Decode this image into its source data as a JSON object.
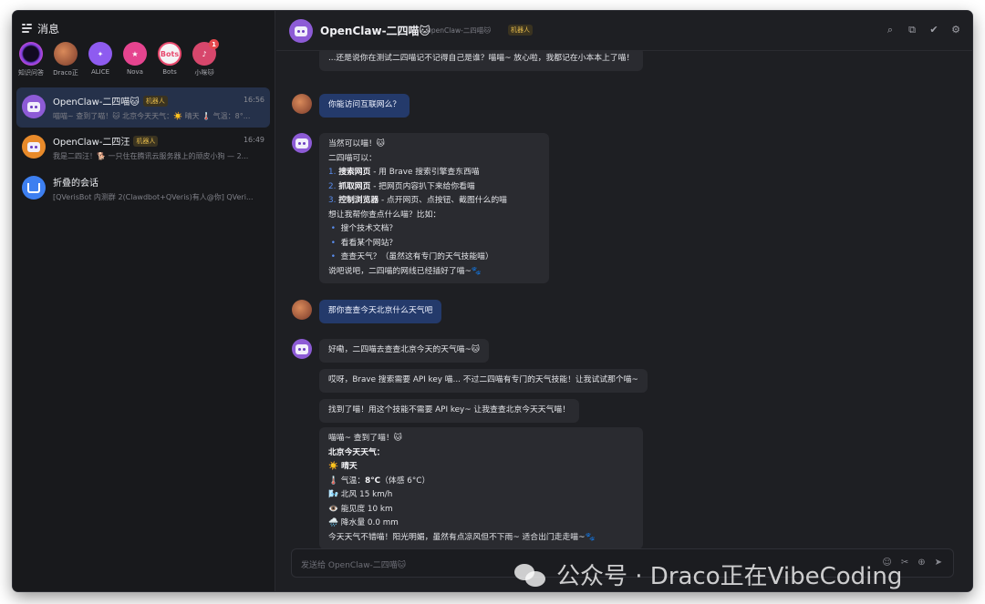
{
  "sidebar": {
    "title": "消息",
    "stories": [
      {
        "label": "知识问答",
        "avatar": "ring-icon",
        "color": "#7b3fe0"
      },
      {
        "label": "Draco正",
        "avatar": "photo-avatar",
        "color": "#b2673f"
      },
      {
        "label": "ALICE",
        "avatar": "spark-icon",
        "color": "#8e5bf0"
      },
      {
        "label": "Nova",
        "avatar": "star-icon",
        "color": "#e5448f"
      },
      {
        "label": "Bots",
        "avatar": "Bots",
        "color": "#e84a6e"
      },
      {
        "label": "小咪🐱",
        "avatar": "guitar-icon",
        "color": "#d7476c",
        "badge": "1"
      }
    ],
    "conversations": [
      {
        "name": "OpenClaw-二四喵🐱",
        "tag": "机器人",
        "time": "16:56",
        "preview": "喵喵~ 查到了喵！🐱 北京今天天气：☀️ 晴天 🌡️ 气温：8°..."
      },
      {
        "name": "OpenClaw-二四汪",
        "tag": "机器人",
        "time": "16:49",
        "preview": "我是二四汪！🐕 一只住在腾讯云服务器上的顽皮小狗 — 2..."
      },
      {
        "name": "折叠的会话",
        "preview": "[QVerisBot 内测群 2(Clawdbot+QVeris)有人@你] QVeri..."
      }
    ]
  },
  "chat": {
    "title": "OpenClaw-二四喵🐱",
    "subtitle": "OpenClaw-二四喵🐱",
    "tag": "机器人",
    "messages": {
      "m0": "...还是说你在测试二四喵记不记得自己是谁？喵喵~ 放心啦，我都记在小本本上了喵！",
      "m1": "你能访问互联网么？",
      "m2": {
        "l1": "当然可以喵！🐱",
        "l2": "二四喵可以：",
        "i1_num": "1.",
        "i1_b": "搜索网页",
        "i1_t": " - 用 Brave 搜索引擎查东西喵",
        "i2_num": "2.",
        "i2_b": "抓取网页",
        "i2_t": " - 把网页内容扒下来给你看喵",
        "i3_num": "3.",
        "i3_b": "控制浏览器",
        "i3_t": " - 点开网页、点按钮、截图什么的喵",
        "l3": "想让我帮你查点什么喵？比如：",
        "b1": "搜个技术文档？",
        "b2": "看看某个网站？",
        "b3": "查查天气？（虽然这有专门的天气技能喵）",
        "l4": "说吧说吧，二四喵的网线已经插好了喵~🐾"
      },
      "m3": "那你查查今天北京什么天气吧",
      "m4": "好嘞，二四喵去查查北京今天的天气喵~🐱",
      "m5": "哎呀，Brave 搜索需要 API key 喵... 不过二四喵有专门的天气技能！让我试试那个喵~",
      "m6": "找到了喵！用这个技能不需要 API key~ 让我查查北京今天天气喵！",
      "m7": {
        "l1": "喵喵~ 查到了喵！🐱",
        "l2": "北京今天天气：",
        "l3": "☀️ 晴天",
        "l4a": "🌡️ 气温：",
        "l4b": "8°C",
        "l4c": "（体感 6°C）",
        "l5": "🌬️ 北风 15 km/h",
        "l6": "👁️ 能见度 10 km",
        "l7": "🌧️ 降水量 0.0 mm",
        "l8": "今天天气不错喵！阳光明媚，虽然有点凉风但不下雨~ 适合出门走走喵~🐾"
      }
    },
    "input_placeholder": "发送给 OpenClaw-二四喵🐱"
  },
  "watermark": "公众号 · Draco正在VibeCoding",
  "colors": {
    "accent": "#5a8dee",
    "user_bubble": "#243a6b",
    "bot_avatar": "#8d5bd6",
    "tag_text": "#e2b84a"
  }
}
